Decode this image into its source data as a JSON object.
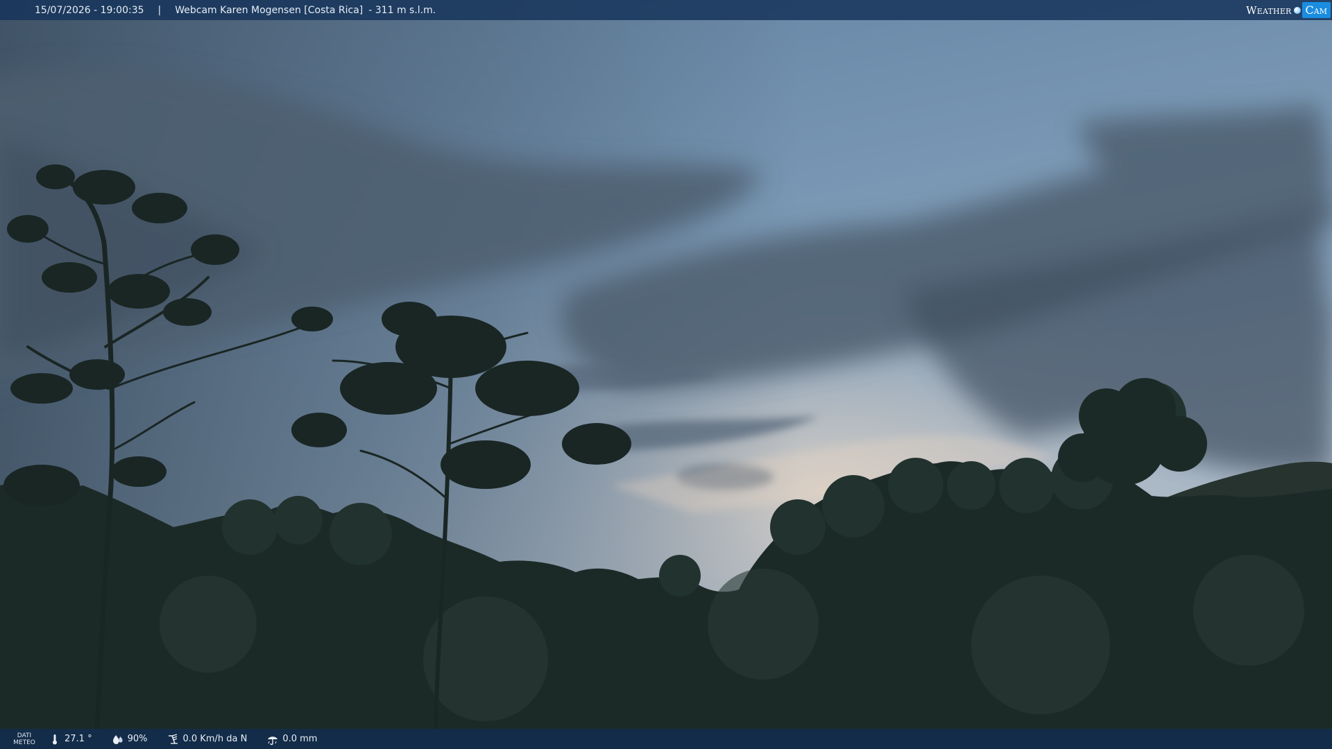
{
  "overlay": {
    "timestamp": "15/07/2026 - 19:00:35",
    "separator": "|",
    "camera_name": "Webcam Karen Mogensen [Costa Rica]",
    "altitude": "- 311 m s.l.m.",
    "logo": {
      "left": "Weather",
      "right": "Cam",
      "accent": "#1a8de0"
    }
  },
  "weather": {
    "label_line1": "DATI",
    "label_line2": "METEO",
    "temperature": "27.1 °",
    "humidity": "90%",
    "wind": "0.0 Km/h da N",
    "rain": "0.0 mm",
    "icons": [
      "thermometer-icon",
      "humidity-icon",
      "wind-icon",
      "rain-icon"
    ]
  },
  "colors": {
    "bar": "#16345a",
    "sky_top": "#6f8fb0",
    "foliage": "#1b2a28"
  }
}
